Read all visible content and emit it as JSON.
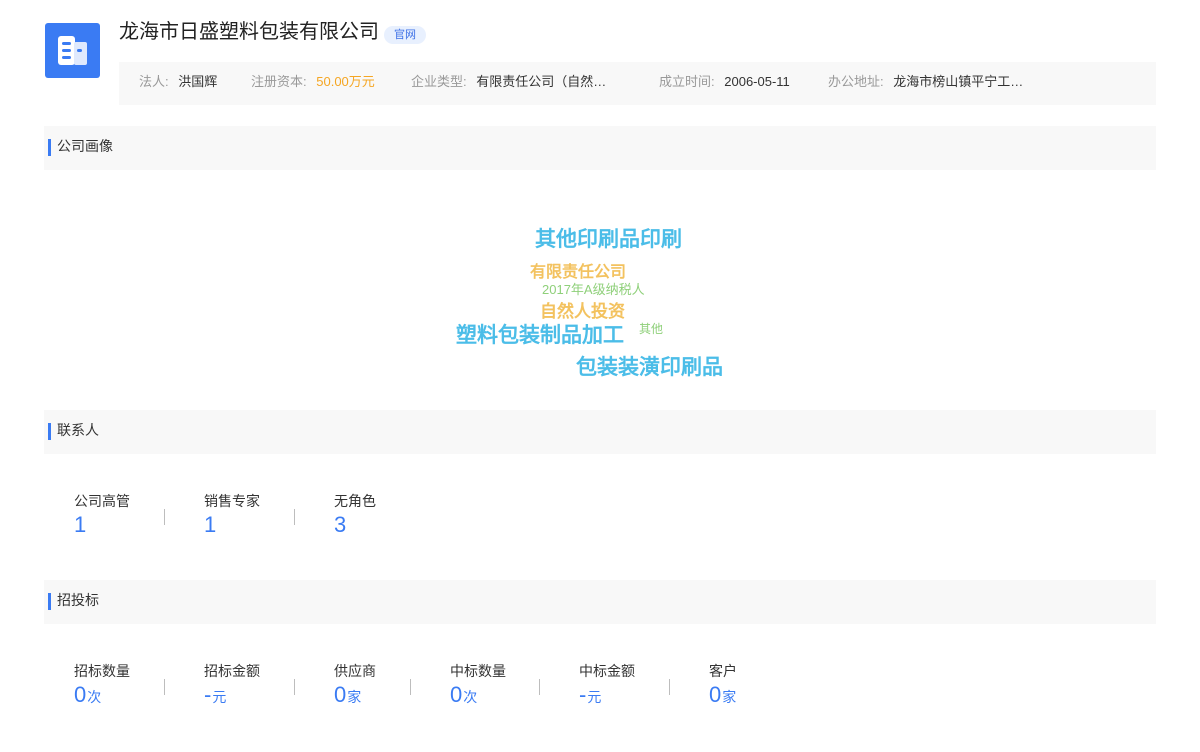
{
  "company": {
    "name": "龙海市日盛塑料包装有限公司",
    "badge": "官网",
    "logo_icon": "building-icon",
    "brand_color": "#3a7bf3"
  },
  "info": {
    "legal_person_label": "法人:",
    "legal_person": "洪国辉",
    "capital_label": "注册资本:",
    "capital": "50.00万元",
    "type_label": "企业类型:",
    "type": "有限责任公司（自然…",
    "founded_label": "成立时间:",
    "founded": "2006-05-11",
    "address_label": "办公地址:",
    "address": "龙海市榜山镇平宁工…"
  },
  "portrait": {
    "title": "公司画像",
    "tags": [
      {
        "text": "其他印刷品印刷",
        "color": "#4bbde8"
      },
      {
        "text": "有限责任公司",
        "color": "#f3c25f"
      },
      {
        "text": "2017年A级纳税人",
        "color": "#8fd07a"
      },
      {
        "text": "自然人投资",
        "color": "#f3c25f"
      },
      {
        "text": "塑料包装制品加工",
        "color": "#4bbde8"
      },
      {
        "text": "其他",
        "color": "#8fd07a"
      },
      {
        "text": "包装装潢印刷品",
        "color": "#4bbde8"
      }
    ]
  },
  "contacts": {
    "title": "联系人",
    "items": [
      {
        "label": "公司高管",
        "value": "1"
      },
      {
        "label": "销售专家",
        "value": "1"
      },
      {
        "label": "无角色",
        "value": "3"
      }
    ]
  },
  "bidding": {
    "title": "招投标",
    "items": [
      {
        "label": "招标数量",
        "value": "0",
        "unit": "次"
      },
      {
        "label": "招标金额",
        "value": "-",
        "unit": "元"
      },
      {
        "label": "供应商",
        "value": "0",
        "unit": "家"
      },
      {
        "label": "中标数量",
        "value": "0",
        "unit": "次"
      },
      {
        "label": "中标金额",
        "value": "-",
        "unit": "元"
      },
      {
        "label": "客户",
        "value": "0",
        "unit": "家"
      }
    ]
  }
}
